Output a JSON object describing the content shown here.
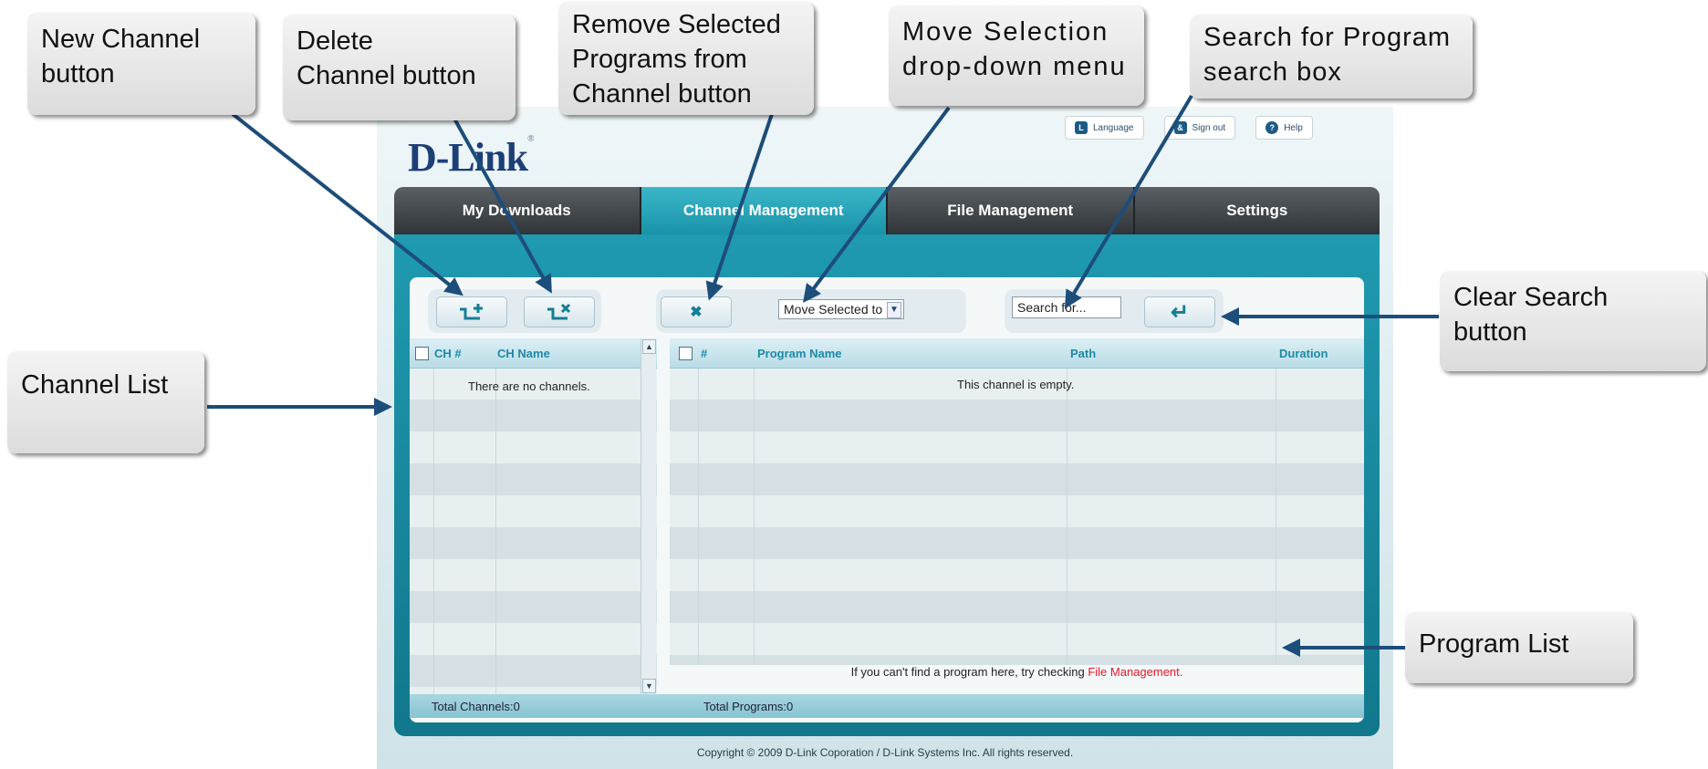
{
  "app": {
    "logo": "D-Link",
    "top_links": [
      {
        "label": "Language",
        "icon": "language-icon",
        "glyph": "L"
      },
      {
        "label": "Sign out",
        "icon": "user-icon",
        "glyph": "&"
      },
      {
        "label": "Help",
        "icon": "help-icon",
        "glyph": "?"
      }
    ],
    "tabs": [
      {
        "label": "My Downloads",
        "active": false
      },
      {
        "label": "Channel Management",
        "active": true
      },
      {
        "label": "File Management",
        "active": false
      },
      {
        "label": "Settings",
        "active": false
      }
    ],
    "toolbar": {
      "new_channel_icon": "new-channel-icon",
      "delete_channel_icon": "delete-channel-icon",
      "remove_glyph": "✖",
      "move_select_value": "Move Selected to",
      "search_value": "Search for...",
      "clear_search_glyph": "↵"
    },
    "channel_list": {
      "columns": [
        "CH #",
        "CH Name"
      ],
      "empty_message": "There are no channels.",
      "total": "Total Channels:0"
    },
    "program_list": {
      "columns": [
        "#",
        "Program Name",
        "Path",
        "Duration"
      ],
      "empty_message": "This channel is empty.",
      "note": "If you can't find a program here, try checking",
      "note_link": "File Management.",
      "total": "Total Programs:0"
    },
    "copyright": "Copyright © 2009 D-Link Coporation / D-Link Systems Inc. All rights reserved.",
    "colors": {
      "accent": "#1a93a8",
      "link": "#e3192a",
      "arrow": "#1d4d7a"
    }
  },
  "callouts": {
    "new_channel": [
      "New Channel",
      "button"
    ],
    "delete_channel": [
      "Delete",
      "Channel button"
    ],
    "remove_selected": [
      "Remove Selected",
      "Programs from",
      "Channel button"
    ],
    "move_selection": [
      "Move Selection",
      "drop-down menu"
    ],
    "search": [
      "Search for Program",
      "search box"
    ],
    "clear_search": [
      "Clear Search",
      "button"
    ],
    "channel_list": [
      "Channel List"
    ],
    "program_list": [
      "Program List"
    ]
  }
}
